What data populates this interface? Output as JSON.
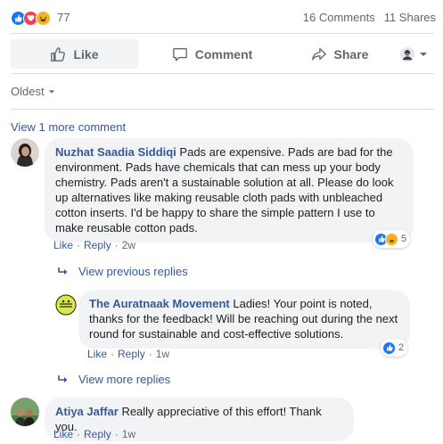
{
  "reactions": {
    "icons": [
      "like-icon",
      "love-icon",
      "haha-icon"
    ],
    "count": "77"
  },
  "stats": {
    "comments": "16 Comments",
    "shares": "11 Shares"
  },
  "actions": {
    "like": "Like",
    "comment": "Comment",
    "share": "Share"
  },
  "sort": {
    "label": "Oldest"
  },
  "view_more_comments": "View 1 more comment",
  "comments": [
    {
      "author": "Nuzhat Saadia Siddiqi",
      "text": "Pads are expensive. Pads are bad for the environment. Pads have chemicals that can mess up your body chemistry. Pads aren't a sustainable solution at all. Please do look up alternatives like making reusable cloth pads with unbleached cotton inserts. I'd be happy to share the simple pattern I use to make reusable cotton pads.",
      "like_label": "Like",
      "reply_label": "Reply",
      "time": "2w",
      "reaction_count": "5",
      "view_previous_replies": "View previous replies",
      "reply": {
        "author": "The Auratnaak Movement",
        "text": "Ladies! Your point is noted, thanks for the feedback! Will be reaching out during the next round for sustainable and cost-effective solutions.",
        "like_label": "Like",
        "reply_label": "Reply",
        "time": "1w",
        "reaction_count": "2"
      },
      "view_more_replies": "View more replies"
    },
    {
      "author": "Atiya Jaffar",
      "text": "Really appreciative of this effort! Thank you.",
      "like_label": "Like",
      "reply_label": "Reply",
      "time": "1w"
    }
  ],
  "colors": {
    "link": "#385898",
    "like_blue": "#1877f2",
    "love_red": "#f33e58",
    "haha_yellow": "#f7b125",
    "muted": "#606770"
  }
}
